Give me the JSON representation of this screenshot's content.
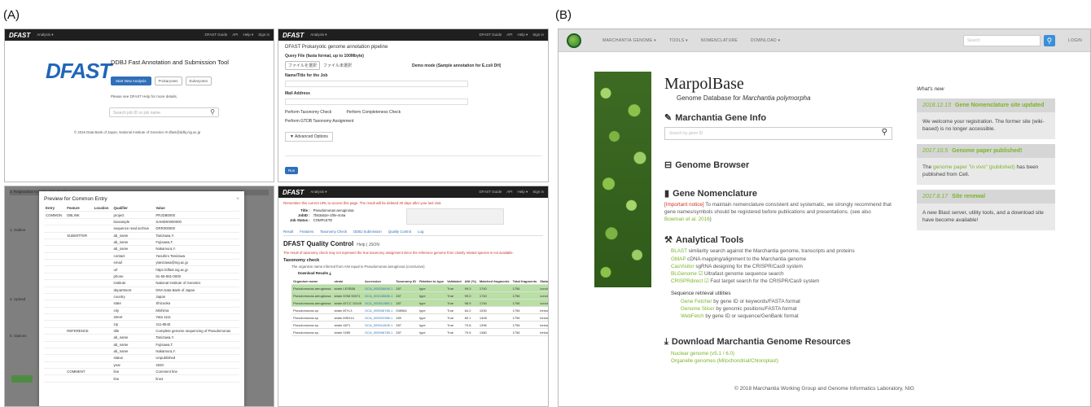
{
  "labels": {
    "a": "(A)",
    "b": "(B)"
  },
  "dfast": {
    "brand": "DFAST",
    "nav_menu": "Analysis ▾",
    "nav_right": [
      "DFAST Guide",
      "API",
      "Help ▾",
      "Sign in"
    ],
    "home": {
      "title": "DDBJ Fast Annotation and Submission Tool",
      "start_button": "Start New Analysis",
      "secondary_tabs": [
        "Prokaryotes",
        "Eukaryotes"
      ],
      "note": "Please see DFAST Help for more details.",
      "search_placeholder": "Search job ID or job name",
      "footer": "© 2016 Data Bank of Japan, National Institute of Genetics   ✉ dfast@ddbj.nig.ac.jp"
    },
    "form": {
      "title": "DFAST Prokaryotic genome annotation pipeline",
      "f1": "Query File (fasta format, up to 100Mbyte)",
      "f1_btn": "ファイルを選択",
      "f1_note": "ファイル未選択",
      "demo": "Demo mode (Sample annotation for E.coli DH)",
      "f2": "Name/Title for the Job",
      "f3": "Mail Address",
      "check1": "Perform Taxonomy Check",
      "check2": "Perform Completeness Check",
      "check3": "Perform GTDB Taxonomy Assignment",
      "advanced": "▼ Advanced Options",
      "run": "Run"
    },
    "preview": {
      "title": "Preview for Common Entry",
      "headers": [
        "Entry",
        "Feature",
        "Location",
        "Qualifier",
        "Value"
      ],
      "rows": [
        [
          "COMMON",
          "DBLINK",
          "",
          "project",
          "PRJDB0000"
        ],
        [
          "",
          "",
          "",
          "biosample",
          "SAMD00000000"
        ],
        [
          "",
          "",
          "",
          "sequence read archive",
          "DRR000000"
        ],
        [
          "",
          "SUBMITTER",
          "",
          "ab_name",
          "Tanizawa,Y."
        ],
        [
          "",
          "",
          "",
          "ab_name",
          "Fujisawa,T."
        ],
        [
          "",
          "",
          "",
          "ab_name",
          "Nakamura,Y."
        ],
        [
          "",
          "",
          "",
          "contact",
          "Yasuhiro Tanizawa"
        ],
        [
          "",
          "",
          "",
          "email",
          "ytanizawa@nig.ac.jp"
        ],
        [
          "",
          "",
          "",
          "url",
          "https://dfast.nig.ac.jp"
        ],
        [
          "",
          "",
          "",
          "phone",
          "81-55-981-0000"
        ],
        [
          "",
          "",
          "",
          "institute",
          "National Institute of Genetics"
        ],
        [
          "",
          "",
          "",
          "department",
          "DNA Data Bank of Japan"
        ],
        [
          "",
          "",
          "",
          "country",
          "Japan"
        ],
        [
          "",
          "",
          "",
          "state",
          "Shizuoka"
        ],
        [
          "",
          "",
          "",
          "city",
          "Mishima"
        ],
        [
          "",
          "",
          "",
          "street",
          "Yata 1111"
        ],
        [
          "",
          "",
          "",
          "zip",
          "411-8540"
        ],
        [
          "",
          "REFERENCE",
          "",
          "title",
          "Complete genome sequencing of Pseudomonas"
        ],
        [
          "",
          "",
          "",
          "ab_name",
          "Tanizawa,Y."
        ],
        [
          "",
          "",
          "",
          "ab_name",
          "Fujisawa,T."
        ],
        [
          "",
          "",
          "",
          "ab_name",
          "Nakamura,Y."
        ],
        [
          "",
          "",
          "",
          "status",
          "Unpublished"
        ],
        [
          "",
          "",
          "",
          "year",
          "2020"
        ],
        [
          "",
          "COMMENT",
          "",
          "line",
          "Comment line"
        ],
        [
          "",
          "",
          "",
          "line",
          "line2"
        ]
      ],
      "bg_items": [
        "2. Registration to Nucleotide Database",
        "1. Outline",
        "4. Upload",
        "5. Options"
      ]
    },
    "qc": {
      "bookmark": "Remember this current URL to access this page. The result will be deleted 30 days after your last visit.",
      "meta_labels": [
        "Title :",
        "JobID :",
        "Job Status :"
      ],
      "meta_values": [
        "Pseudomonas aeruginosa",
        "7b53a52e-1f0e-4c6a",
        "COMPLETE"
      ],
      "tabs": [
        "Result",
        "Features",
        "Taxonomy Check",
        "DDBJ Submission",
        "Quality Control",
        "Log"
      ],
      "title": "DFAST Quality Control",
      "title_small": "Help | JSON",
      "warning": "The result of taxonomy check may not represent the true taxonomy assignment since the reference genome from closely related species is not available.",
      "section": "Taxonomy check",
      "sub": "The organism name inferred from ANI equal to Pseudomonas aeruginosa (conclusive)",
      "download": "Download Results",
      "headers": [
        "Organism name",
        "strain",
        "Accession",
        "Taxonomy ID",
        "Relation to type",
        "Validated",
        "ANI (%)",
        "Matched fragments",
        "Total fragments",
        "Status"
      ],
      "rows": [
        [
          "Pseudomonas aeruginosa",
          "strain LESB58",
          "GCA_000026645.1",
          "287",
          "type",
          "True",
          "99.3",
          "1740",
          "1756",
          "conclusive"
        ],
        [
          "Pseudomonas aeruginosa",
          "strain DSM 50071",
          "GCA_001045685.1",
          "287",
          "type",
          "True",
          "99.0",
          "1740",
          "1756",
          "conclusive"
        ],
        [
          "Pseudomonas aeruginosa",
          "strain ATCC 10145",
          "GCA_000511585.1",
          "287",
          "type",
          "True",
          "98.9",
          "1740",
          "1756",
          "conclusive"
        ],
        [
          "Pseudomonas sp.",
          "strain ATH-3",
          "GCA_000006765.1",
          "208964",
          "type",
          "True",
          "84.2",
          "1530",
          "1756",
          "below_threshold"
        ],
        [
          "Pseudomonas sp.",
          "strain MSH14",
          "GCA_000022385.1",
          "289",
          "type",
          "True",
          "80.1",
          "1408",
          "1756",
          "below_threshold"
        ],
        [
          "Pseudomonas sp.",
          "strain 4871",
          "GCA_000014625.1",
          "287",
          "type",
          "True",
          "79.8",
          "1396",
          "1756",
          "below_threshold"
        ],
        [
          "Pseudomonas sp.",
          "strain 0289",
          "GCA_000006765.1",
          "287",
          "type",
          "True",
          "79.5",
          "1380",
          "1756",
          "below_threshold"
        ]
      ]
    }
  },
  "marpol": {
    "nav": [
      "MARCHANTIA GENOME ▾",
      "TOOLS ▾",
      "NOMENCLATURE",
      "DOWNLOAD ▾"
    ],
    "search_placeholder": "Search",
    "nav_right": "LOGIN",
    "title": "MarpolBase",
    "subtitle_pre": "Genome Database for ",
    "subtitle_species": "Marchantia polymorpha",
    "gene_info": {
      "heading": "Marchantia Gene Info",
      "placeholder": "Search by gene ID"
    },
    "genome_browser": "Genome Browser",
    "nomenclature": {
      "heading": "Gene Nomenclature",
      "notice": "[Important notice]",
      "text": "To maintain nomenclature consistent and systematic, we strongly recommend that gene names/symbols should be registered before publications and presentations. (see also ",
      "link": "Bowman et al. 2016",
      "end": ")"
    },
    "tools": {
      "heading": "Analytical Tools",
      "items": [
        {
          "name": "BLAST",
          "desc": " similarity search against the Marchantia genome, transcripts and proteins"
        },
        {
          "name": "GMAP",
          "desc": " cDNA mapping/alignment to the Marchantia genome"
        },
        {
          "name": "CasVisitor",
          "desc": " sgRNA designing for the CRISPR/Cas9 system"
        },
        {
          "name": "BLGenome ☑",
          "desc": " Ultrafast genome sequence search"
        },
        {
          "name": "CRISPRdirect ☑",
          "desc": " Fast target search for the CRISPR/Cas9 system"
        }
      ],
      "retrieval_heading": "Sequence retrieval utilities",
      "retrieval": [
        {
          "name": "Gene Fetcher",
          "desc": " by gene ID or keywords/FASTA format"
        },
        {
          "name": "Genome Slicer",
          "desc": " by genomic positions/FASTA format"
        },
        {
          "name": "WebFetch",
          "desc": " by gene ID or sequence/GenBank format"
        }
      ]
    },
    "download": {
      "heading": "Download Marchantia Genome Resources",
      "links": [
        "Nuclear genome (v5.1 / 6.0)",
        "Organelle genomes (Mitochondrial/Chloroplast)"
      ]
    },
    "whats_new": {
      "heading": "What's new",
      "items": [
        {
          "date": "2018.12.13",
          "title": "Gene Nomenclature site updated",
          "body": "We welcome your registration. The former site (wiki-based) is no longer accessible."
        },
        {
          "date": "2017.10.5",
          "title": "Genome paper published!",
          "body_pre": "The ",
          "link": "genome paper \"in vivo\" (published)",
          "body_post": " has been published from Cell."
        },
        {
          "date": "2017.8.17",
          "title": "Site renewal",
          "body": "A new Blast server, utility tools, and a download site have become available!"
        }
      ]
    },
    "footer": "© 2018 Marchantia Working Group and Genome Informatics Laboratory, NIG"
  }
}
